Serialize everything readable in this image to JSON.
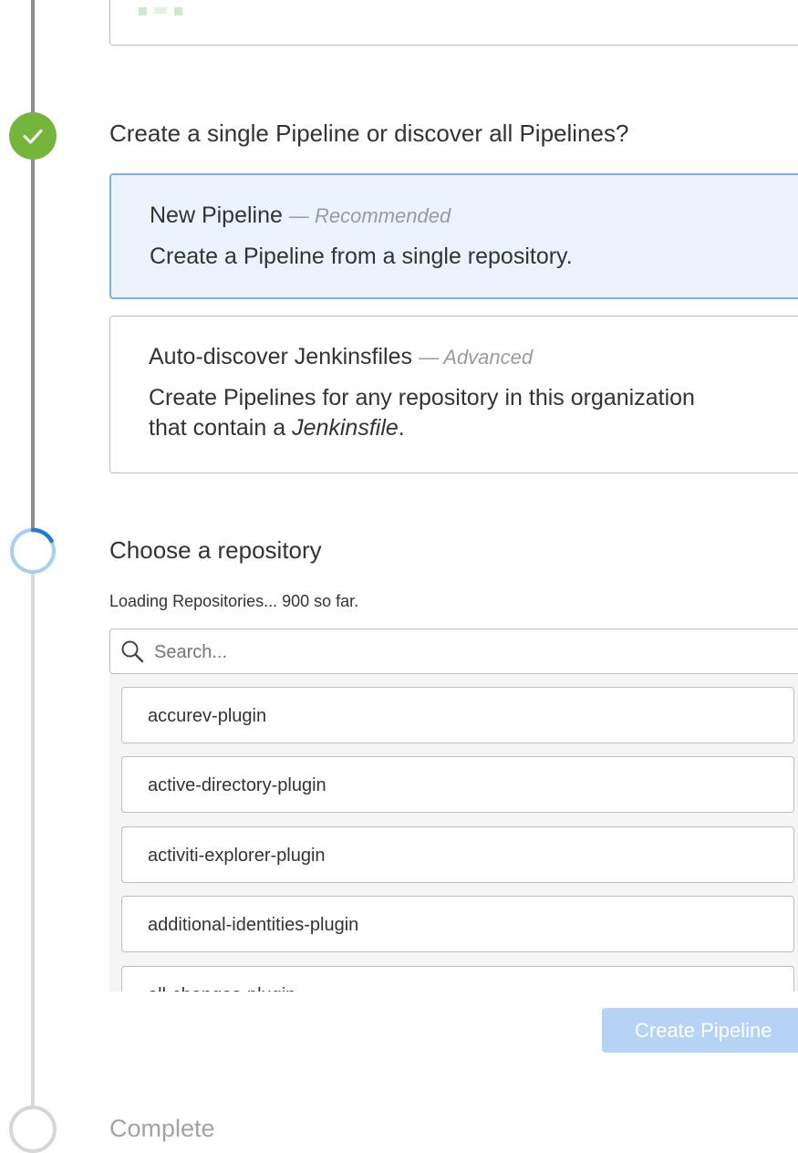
{
  "steps": {
    "pipeline_type": {
      "heading": "Create a single Pipeline or discover all Pipelines?",
      "options": [
        {
          "title": "New Pipeline",
          "tag": "— Recommended",
          "description": "Create a Pipeline from a single repository."
        },
        {
          "title": "Auto-discover Jenkinsfiles",
          "tag": "— Advanced",
          "description_before": "Create Pipelines for any repository in this organization that contain a ",
          "description_em": "Jenkinsfile",
          "description_after": "."
        }
      ]
    },
    "repository": {
      "heading": "Choose a repository",
      "loading_text": "Loading Repositories... 900 so far.",
      "search_placeholder": "Search...",
      "repos": [
        "accurev-plugin",
        "active-directory-plugin",
        "activiti-explorer-plugin",
        "additional-identities-plugin",
        "all-changes-plugin"
      ],
      "create_button": "Create Pipeline"
    },
    "complete": {
      "label": "Complete"
    }
  },
  "colors": {
    "complete": "#76b53c",
    "active": "#1f7ed0",
    "selected_bg": "#eaf3fe",
    "button_disabled": "#b5d3f5"
  },
  "icons": {
    "step_complete": "check-icon",
    "search": "search-icon"
  }
}
